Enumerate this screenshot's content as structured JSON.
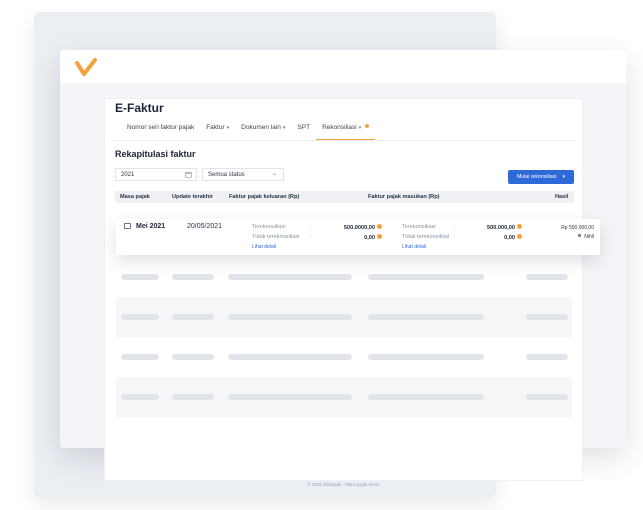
{
  "app": {
    "page_title": "E-Faktur",
    "brand_color": "#f2a23a",
    "accent_color": "#2d6ad8"
  },
  "tabs": [
    {
      "label": "Nomor seri faktur pajak",
      "has_chevron": false
    },
    {
      "label": "Faktur",
      "has_chevron": true
    },
    {
      "label": "Dokumen lain",
      "has_chevron": true
    },
    {
      "label": "SPT",
      "has_chevron": false
    },
    {
      "label": "Rekonsiliasi",
      "has_chevron": true,
      "active": true,
      "badge": "dot"
    }
  ],
  "section": {
    "title": "Rekapitulasi faktur"
  },
  "filters": {
    "year_value": "2021",
    "year_icon": "calendar-icon",
    "status_value": "Semua status",
    "status_icon": "chevron-down-icon"
  },
  "actions": {
    "start_reconciliation": "Mulai rekonsiliasi"
  },
  "table": {
    "columns": [
      "Masa pajak",
      "Update terakhir",
      "Faktur pajak keluaran (Rp)",
      "Faktur pajak masukan (Rp)",
      "Hasil"
    ],
    "row": {
      "period": "Mei 2021",
      "updated": "20/05/2021",
      "keluaran": {
        "reconciled_label": "Terekonsiliasi",
        "reconciled_value": "500.0000,00",
        "unreconciled_label": "Tidak terekonsiliasi",
        "unreconciled_value": "0,00",
        "link": "Lihat detail"
      },
      "masukan": {
        "reconciled_label": "Terekonsiliasi",
        "reconciled_value": "500.000,00",
        "unreconciled_label": "Tidak terekonsiliasi",
        "unreconciled_value": "0,00",
        "link": "Lihat detail"
      },
      "result_value": "Rp 500.000,00",
      "result_status": "Nihil"
    }
  },
  "footer": {
    "text": "© 2021 Klikpajak - Mitra pajak resmi"
  }
}
